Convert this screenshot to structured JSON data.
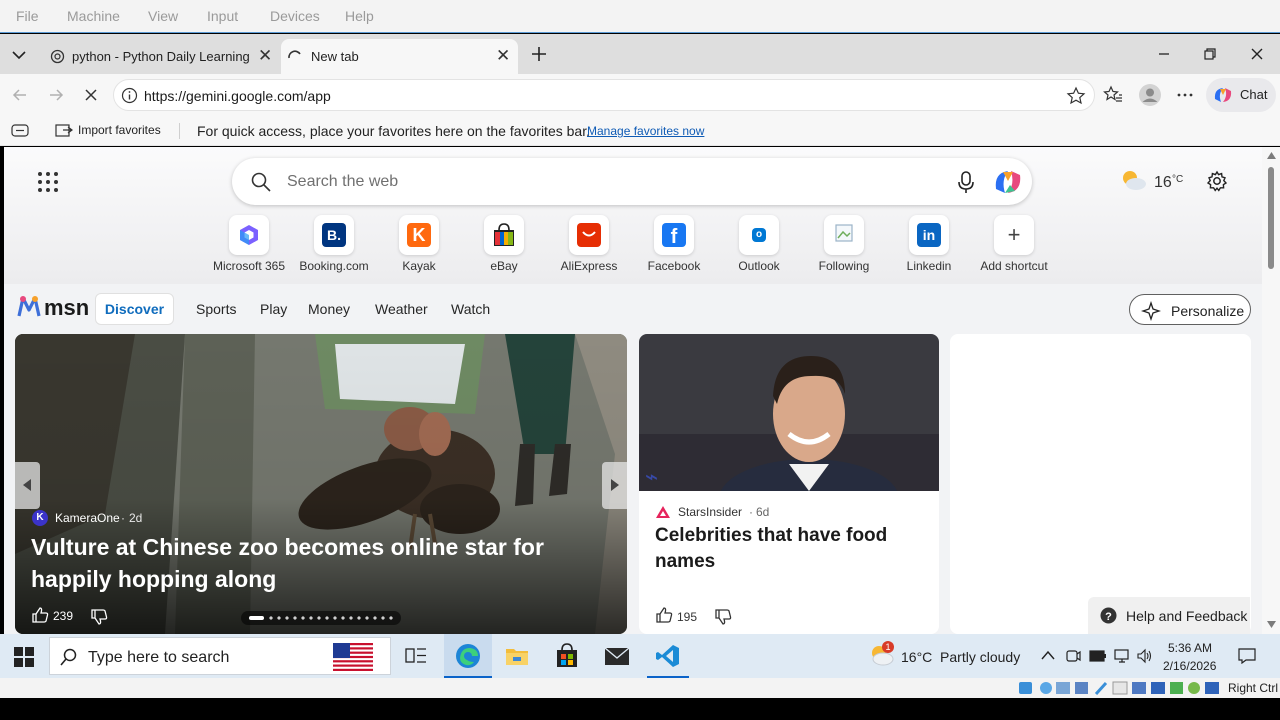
{
  "vm_menu": [
    "File",
    "Machine",
    "View",
    "Input",
    "Devices",
    "Help"
  ],
  "tabs": [
    {
      "title": "python - Python Daily Learning Pa"
    },
    {
      "title": "New tab"
    }
  ],
  "address": {
    "url": "https://gemini.google.com/app"
  },
  "toolbar": {
    "chat_label": "Chat"
  },
  "favorites_bar": {
    "import_label": "Import favorites",
    "message": "For quick access, place your favorites here on the favorites bar.",
    "manage_link": "Manage favorites now"
  },
  "newtab": {
    "search_placeholder": "Search the web",
    "weather_temp": "16",
    "weather_unit": "°C",
    "shortcuts": [
      {
        "label": "Microsoft 365",
        "icon": "microsoft365-icon",
        "color": "#7b61ff"
      },
      {
        "label": "Booking.com",
        "icon": "booking-icon",
        "color": "#003580",
        "glyph": "B."
      },
      {
        "label": "Kayak",
        "icon": "kayak-icon",
        "color": "#ff690f",
        "glyph": "K"
      },
      {
        "label": "eBay",
        "icon": "ebay-icon",
        "color": "#e53238"
      },
      {
        "label": "AliExpress",
        "icon": "aliexpress-icon",
        "color": "#e62e04"
      },
      {
        "label": "Facebook",
        "icon": "facebook-icon",
        "color": "#1877f2",
        "glyph": "f"
      },
      {
        "label": "Outlook",
        "icon": "outlook-icon",
        "color": "#0078d4",
        "glyph": "o"
      },
      {
        "label": "Following",
        "icon": "following-icon",
        "color": "#9bb3c8"
      },
      {
        "label": "Linkedin",
        "icon": "linkedin-icon",
        "color": "#0a66c2",
        "glyph": "in"
      },
      {
        "label": "Add shortcut",
        "icon": "plus-icon",
        "color": "#444444",
        "glyph": "+"
      }
    ]
  },
  "msn": {
    "brand": "msn",
    "tabs": [
      "Discover",
      "Sports",
      "Play",
      "Money",
      "Weather",
      "Watch"
    ],
    "personalize_label": "Personalize",
    "hero": {
      "source_initial": "K",
      "source": "KameraOne",
      "age": "2d",
      "headline": "Vulture at Chinese zoo becomes online star for happily hopping along",
      "likes": "239"
    },
    "card2": {
      "source": "StarsInsider",
      "age": "6d",
      "headline": "Celebrities that have food names",
      "likes": "195"
    },
    "help_label": "Help and Feedback"
  },
  "taskbar": {
    "search_placeholder": "Type here to search",
    "weather": "16°C  Partly cloudy",
    "weather_badge": "1",
    "time": "5:36 AM",
    "date": "2/16/2026"
  },
  "vm_status": {
    "host_key": "Right Ctrl"
  }
}
